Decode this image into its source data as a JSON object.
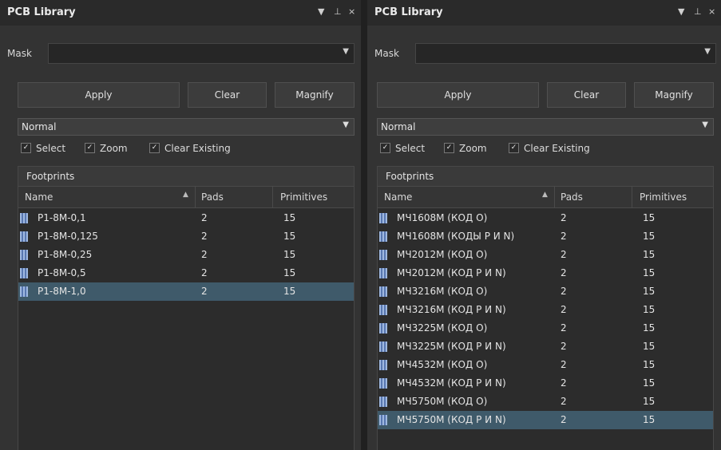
{
  "panels": [
    {
      "title": "PCB Library",
      "title_controls": [
        "▼",
        "⊥",
        "×"
      ],
      "mask_label": "Mask",
      "mask_value": "",
      "buttons": {
        "apply": "Apply",
        "clear": "Clear",
        "magnify": "Magnify"
      },
      "mode": "Normal",
      "checkboxes": [
        "Select",
        "Zoom",
        "Clear Existing"
      ],
      "section": "Footprints",
      "columns": [
        "Name",
        "Pads",
        "Primitives"
      ],
      "rows": [
        {
          "name": "P1-8M-0,1",
          "pads": "2",
          "primitives": "15"
        },
        {
          "name": "P1-8M-0,125",
          "pads": "2",
          "primitives": "15"
        },
        {
          "name": "P1-8M-0,25",
          "pads": "2",
          "primitives": "15"
        },
        {
          "name": "P1-8M-0,5",
          "pads": "2",
          "primitives": "15"
        },
        {
          "name": "P1-8M-1,0",
          "pads": "2",
          "primitives": "15"
        }
      ],
      "selected_row": 4
    },
    {
      "title": "PCB Library",
      "title_controls": [
        "▼",
        "⊥",
        "×"
      ],
      "mask_label": "Mask",
      "mask_value": "",
      "buttons": {
        "apply": "Apply",
        "clear": "Clear",
        "magnify": "Magnify"
      },
      "mode": "Normal",
      "checkboxes": [
        "Select",
        "Zoom",
        "Clear Existing"
      ],
      "section": "Footprints",
      "columns": [
        "Name",
        "Pads",
        "Primitives"
      ],
      "rows": [
        {
          "name": "МЧ1608М (КОД О)",
          "pads": "2",
          "primitives": "15"
        },
        {
          "name": "МЧ1608М (КОДЫ Р И N)",
          "pads": "2",
          "primitives": "15"
        },
        {
          "name": "МЧ2012М (КОД О)",
          "pads": "2",
          "primitives": "15"
        },
        {
          "name": "МЧ2012М (КОД Р И N)",
          "pads": "2",
          "primitives": "15"
        },
        {
          "name": "МЧ3216М (КОД О)",
          "pads": "2",
          "primitives": "15"
        },
        {
          "name": "МЧ3216М (КОД Р И N)",
          "pads": "2",
          "primitives": "15"
        },
        {
          "name": "МЧ3225М (КОД О)",
          "pads": "2",
          "primitives": "15"
        },
        {
          "name": "МЧ3225М (КОД Р И N)",
          "pads": "2",
          "primitives": "15"
        },
        {
          "name": "МЧ4532М (КОД О)",
          "pads": "2",
          "primitives": "15"
        },
        {
          "name": "МЧ4532М (КОД Р И N)",
          "pads": "2",
          "primitives": "15"
        },
        {
          "name": "МЧ5750М (КОД О)",
          "pads": "2",
          "primitives": "15"
        },
        {
          "name": "МЧ5750М (КОД Р И N)",
          "pads": "2",
          "primitives": "15"
        }
      ],
      "selected_row": 11
    }
  ],
  "icons": {
    "dropdown": "chevron-down-icon",
    "pin": "pin-icon",
    "close": "close-icon",
    "check": "check-icon",
    "footprint": "footprint-icon",
    "sort": "sort-up-icon"
  },
  "colors": {
    "background": "#333333",
    "selection": "#3f5a6a",
    "footprint_icon": "#7a97cc"
  }
}
